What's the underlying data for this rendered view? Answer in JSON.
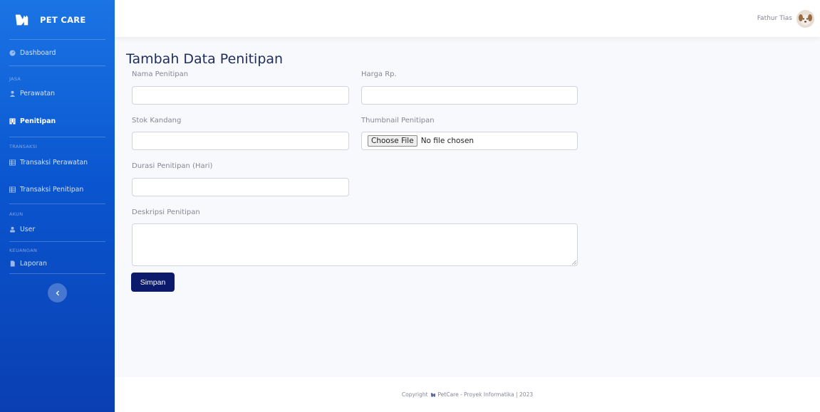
{
  "brand": {
    "name": "PET CARE",
    "logo_icon": "cat-logo-icon"
  },
  "sidebar": {
    "dashboard": {
      "label": "Dashboard",
      "icon": "dashboard-icon"
    },
    "sections": [
      {
        "heading": "JASA",
        "items": [
          {
            "label": "Perawatan",
            "icon": "user-tie-icon",
            "active": false
          },
          {
            "label": "Penitipan",
            "icon": "hotel-icon",
            "active": true
          }
        ]
      },
      {
        "heading": "TRANSAKSI",
        "items": [
          {
            "label": "Transaksi Perawatan",
            "icon": "table-icon",
            "active": false
          },
          {
            "label": "Transaksi Penitipan",
            "icon": "table-icon",
            "active": false
          }
        ]
      },
      {
        "heading": "AKUN",
        "items": [
          {
            "label": "User",
            "icon": "user-icon",
            "active": false
          }
        ]
      },
      {
        "heading": "KEUANGAN",
        "items": [
          {
            "label": "Laporan",
            "icon": "file-icon",
            "active": false
          }
        ]
      }
    ],
    "toggle_icon": "chevron-left-icon"
  },
  "topbar": {
    "user_name": "Fathur Tias",
    "avatar_icon": "avatar"
  },
  "form": {
    "title": "Tambah Data Penitipan",
    "nama_label": "Nama Penitipan",
    "nama_value": "",
    "harga_label": "Harga Rp.",
    "harga_value": "",
    "stok_label": "Stok Kandang",
    "stok_value": "",
    "thumbnail_label": "Thumbnail Penitipan",
    "file_button": "Choose File",
    "file_status": "No file chosen",
    "durasi_label": "Durasi Penitipan (Hari)",
    "durasi_value": "",
    "deskripsi_label": "Deskripsi Penitipan",
    "deskripsi_value": "",
    "submit_label": "Simpan"
  },
  "footer": {
    "prefix": "Copyright",
    "text": "PetCare - Proyek Informatika | 2023"
  },
  "colors": {
    "sidebar_top": "#1b74e4",
    "sidebar_bottom": "#0a3fb2",
    "primary_button": "#0b1a6b",
    "title": "#1f2d5c"
  }
}
